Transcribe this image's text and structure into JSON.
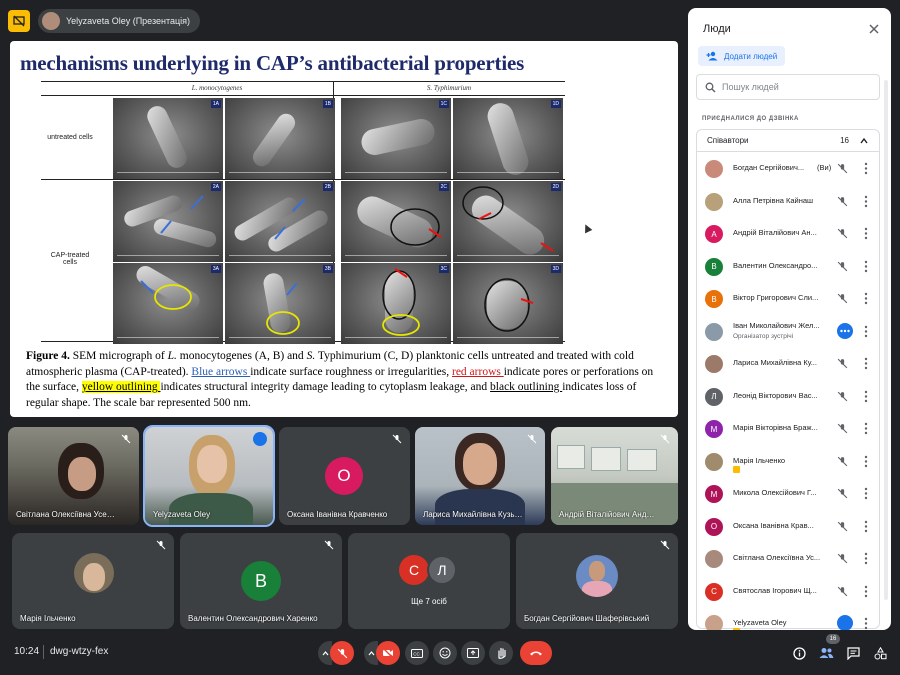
{
  "topbar": {
    "presenter_label": "Yelyzaveta Oley (Презентація)"
  },
  "slide": {
    "title": "mechanisms underlying in CAP’s antibacterial properties",
    "col1": "L. monocytogenes",
    "col2": "S. Typhimurium",
    "row1": "untreated cells",
    "row2a": "CAP-treated",
    "row2b": "cells",
    "labels": [
      "1A",
      "1B",
      "1C",
      "1D",
      "2A",
      "2B",
      "2C",
      "2D",
      "3A",
      "3B",
      "3C",
      "3D"
    ],
    "caption": {
      "p1": "Figure 4.",
      "p2": " SEM micrograph of ",
      "p3": "L.",
      "p4": " monocytogenes (A, B) and ",
      "p5": "S.",
      "p6": " Typhimurium (C, D) planktonic cells untreated and treated with cold atmospheric plasma (CAP-treated). ",
      "blue": "Blue arrows ",
      "p7": "indicate surface roughness or irregularities, ",
      "red": "red arrows ",
      "p8": "indicate pores or perforations on the surface, ",
      "yellow": "yellow outlining ",
      "p9": "indicates structural integrity damage leading to cytoplasm leakage, and ",
      "black": "black outlining ",
      "p10": "indicates loss of regular shape. The scale bar represented 500 nm."
    }
  },
  "tiles": [
    {
      "name": "Світлана Олексіївна Усенко"
    },
    {
      "name": "Yelyzaveta Oley"
    },
    {
      "name": "Оксана Іванівна Кравченко",
      "initial": "О"
    },
    {
      "name": "Лариса Михайлівна Кузьм..."
    },
    {
      "name": "Андрій Віталійович Андру..."
    },
    {
      "name": "Марія Ільченко"
    },
    {
      "name": "Валентин Олександрович Харенко",
      "initial": "В"
    },
    {
      "name": "Ще 7 осіб",
      "initials": [
        "С",
        "Л"
      ]
    },
    {
      "name": "Богдан Сергійович Шаферівський"
    }
  ],
  "bottombar": {
    "time": "10:24",
    "code": "dwg-wtzy-fex",
    "participants_badge": "16"
  },
  "panel": {
    "title": "Люди",
    "add_label": "Додати людей",
    "search_placeholder": "Пошук людей",
    "joined_label": "ПРИЄДНАЛИСЯ ДО ДЗВІНКА",
    "group_label": "Співавтори",
    "group_count": "16",
    "people": [
      {
        "name": "Богдан Сергійович...",
        "you": "(Ви)",
        "initial": ""
      },
      {
        "name": "Алла Петрівна Кайнаш",
        "initial": ""
      },
      {
        "name": "Андрій Віталійович Ан...",
        "initial": "А"
      },
      {
        "name": "Валентин Олександро...",
        "initial": "В"
      },
      {
        "name": "Віктор Григорович Сли...",
        "initial": "В"
      },
      {
        "name": "Іван Миколайович Жел...",
        "sub": "Організатор зустрічі",
        "initial": ""
      },
      {
        "name": "Лариса Михайлівна Ку...",
        "initial": ""
      },
      {
        "name": "Леонід Вікторович Вас...",
        "initial": "Л"
      },
      {
        "name": "Марія Вікторівна Браж...",
        "initial": "М"
      },
      {
        "name": "Марія Ільченко",
        "initial": ""
      },
      {
        "name": "Микола Олексійович Г...",
        "initial": "М"
      },
      {
        "name": "Оксана Іванівна Крав...",
        "initial": "О"
      },
      {
        "name": "Світлана Олексіївна Ус...",
        "initial": ""
      },
      {
        "name": "Святослав Ігорович Щ...",
        "initial": "С"
      },
      {
        "name": "Yelyzaveta Oley",
        "initial": ""
      }
    ]
  },
  "colors": {
    "accent": "#1a73e8",
    "danger": "#ea4335",
    "slide_title": "#1f2a6b",
    "avatar_pink": "#d81b60",
    "avatar_green": "#188038",
    "avatar_orange": "#e8710a",
    "avatar_purple": "#8e24aa",
    "avatar_gray": "#5f6368",
    "avatar_red": "#d93025",
    "avatar_magenta": "#ad1457"
  },
  "icons": [
    "present-icon",
    "mic-off-icon",
    "camera-off-icon",
    "captions-icon",
    "emoji-icon",
    "present-now-icon",
    "raise-hand-icon",
    "end-call-icon",
    "info-icon",
    "people-icon",
    "chat-icon",
    "activities-icon",
    "close-icon",
    "search-icon",
    "add-person-icon",
    "chevron-up-icon",
    "more-vert-icon",
    "speaking-icon"
  ]
}
